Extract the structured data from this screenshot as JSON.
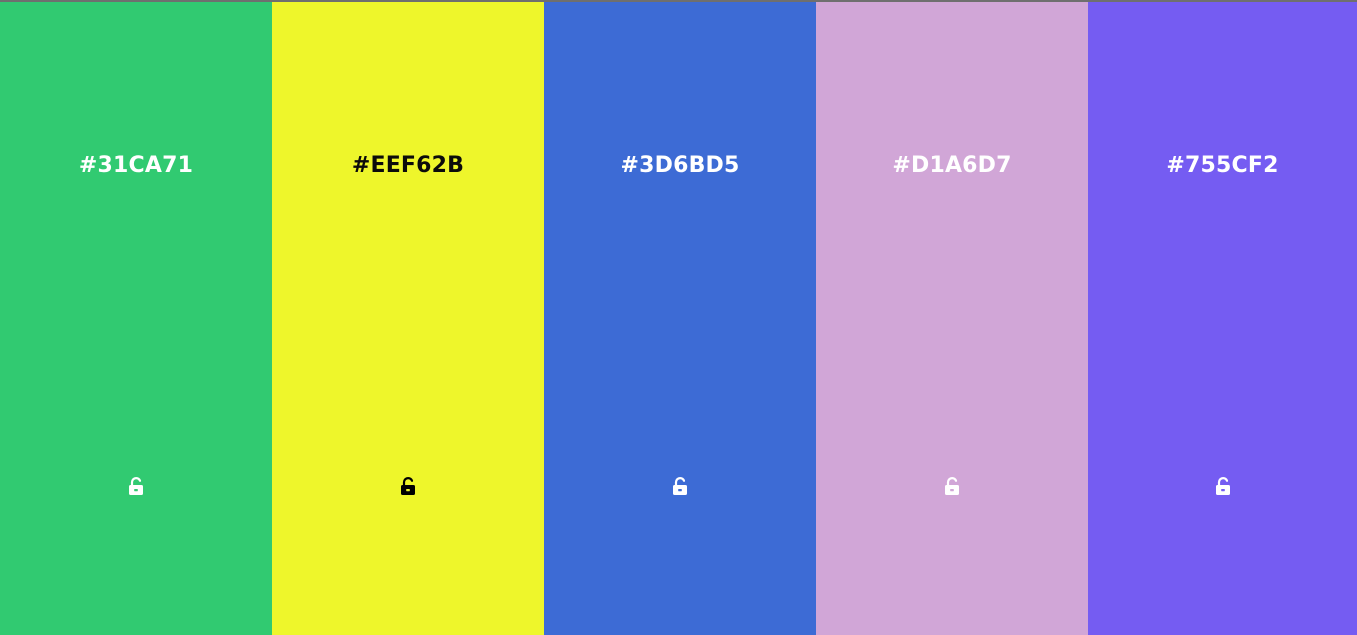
{
  "palette": {
    "columns": [
      {
        "hex_label": "#31CA71",
        "background": "#31CA71",
        "text_color": "#FFFFFF",
        "lock_icon": "unlocked-padlock-icon"
      },
      {
        "hex_label": "#EEF62B",
        "background": "#EEF62B",
        "text_color": "#000000",
        "lock_icon": "unlocked-padlock-icon"
      },
      {
        "hex_label": "#3D6BD5",
        "background": "#3D6BD5",
        "text_color": "#FFFFFF",
        "lock_icon": "unlocked-padlock-icon"
      },
      {
        "hex_label": "#D1A6D7",
        "background": "#D1A6D7",
        "text_color": "#FFFFFF",
        "lock_icon": "unlocked-padlock-icon"
      },
      {
        "hex_label": "#755CF2",
        "background": "#755CF2",
        "text_color": "#FFFFFF",
        "lock_icon": "unlocked-padlock-icon"
      }
    ]
  }
}
